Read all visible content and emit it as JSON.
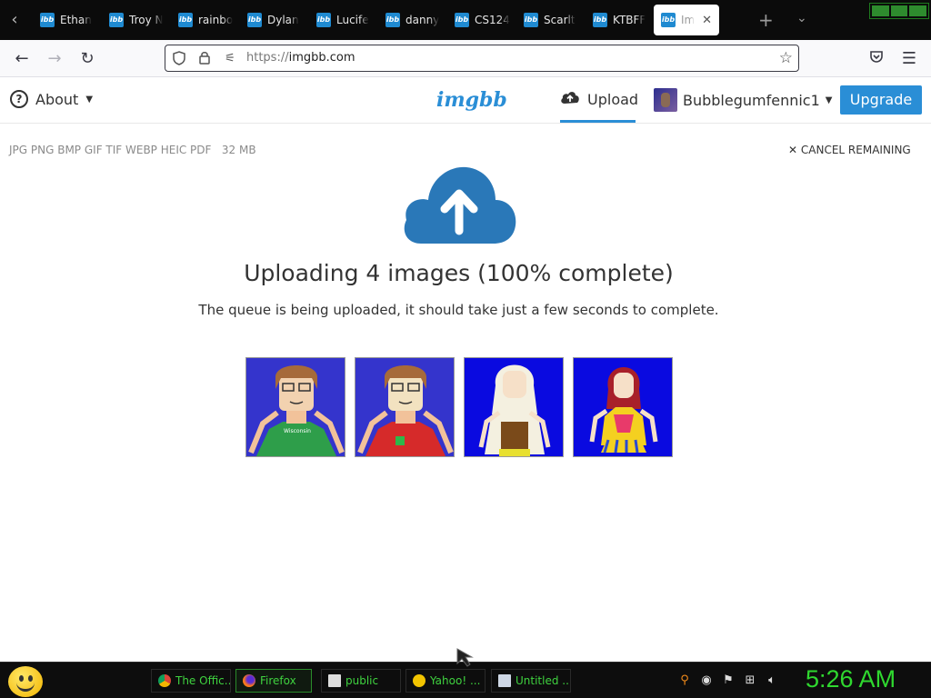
{
  "browser": {
    "tabs": [
      {
        "label": "Ethan"
      },
      {
        "label": "Troy N"
      },
      {
        "label": "rainbo"
      },
      {
        "label": "Dylan"
      },
      {
        "label": "Lucife"
      },
      {
        "label": "danny"
      },
      {
        "label": "CS124"
      },
      {
        "label": "Scarlt"
      },
      {
        "label": "KTBFF"
      },
      {
        "label": "Im"
      }
    ],
    "favicon_text": "ibb",
    "url_scheme": "https://",
    "url_host": "imgbb.com",
    "icons": {
      "back": "arrow-left-icon",
      "forward": "arrow-right-icon",
      "reload": "reload-icon",
      "shield": "shield-icon",
      "lock": "lock-icon",
      "star": "star-icon",
      "pocket": "pocket-icon",
      "menu": "hamburger-menu-icon"
    }
  },
  "site": {
    "about_label": "About",
    "logo": "imgbb",
    "upload_label": "Upload",
    "username": "Bubblegumfennic1",
    "upgrade_label": "Upgrade",
    "accent_color": "#2a8ed6"
  },
  "upload": {
    "formats": "JPG PNG BMP GIF TIF WEBP HEIC PDF",
    "max_size": "32 MB",
    "cancel_label": "CANCEL REMAINING",
    "heading": "Uploading 4 images (100% complete)",
    "subtext": "The queue is being uploaded, it should take just a few seconds to complete.",
    "images": [
      {
        "shirt_text": "Wisconsin"
      },
      {
        "shirt_text": ""
      },
      {
        "shirt_text": ""
      },
      {
        "shirt_text": ""
      }
    ]
  },
  "taskbar": {
    "tasks": [
      {
        "label": "The Offic..."
      },
      {
        "label": "Firefox"
      },
      {
        "label": "public"
      },
      {
        "label": "Yahoo! ..."
      },
      {
        "label": "Untitled ..."
      }
    ],
    "clock": "5:26 AM"
  }
}
